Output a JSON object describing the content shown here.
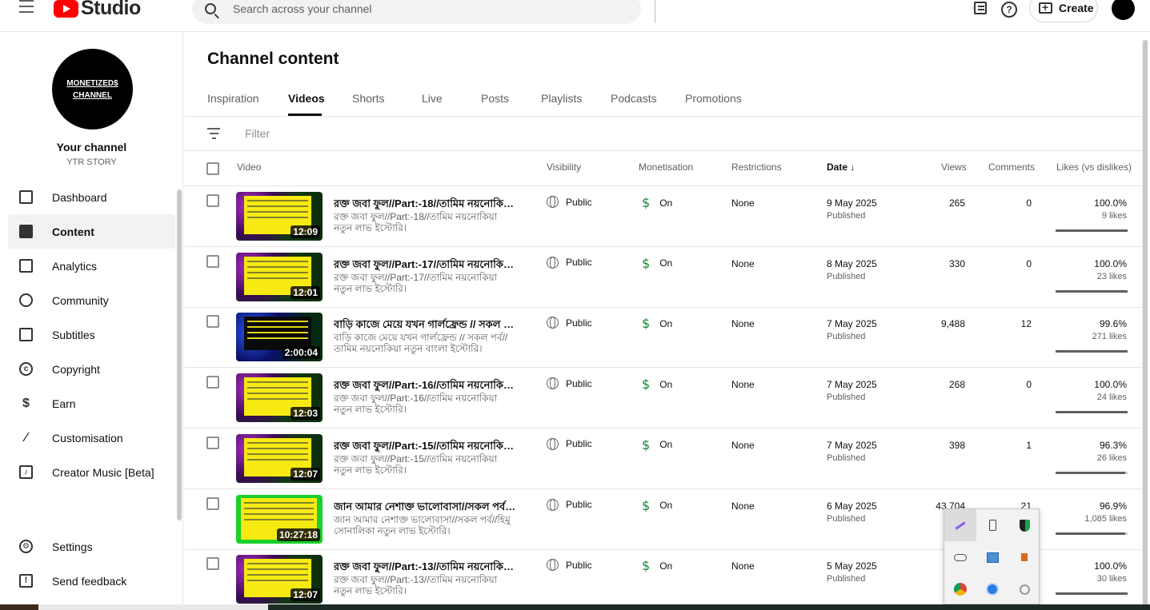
{
  "app": {
    "logo_text": "Studio"
  },
  "search": {
    "placeholder": "Search across your channel"
  },
  "header": {
    "create_label": "Create"
  },
  "channel": {
    "avatar_line1": "MONETIZED$",
    "avatar_line2": "CHANNEL",
    "title": "Your channel",
    "name": "YTR STORY"
  },
  "sidebar": {
    "items": [
      {
        "label": "Dashboard",
        "icon": "dashboard-icon"
      },
      {
        "label": "Content",
        "icon": "content-icon",
        "active": true
      },
      {
        "label": "Analytics",
        "icon": "analytics-icon"
      },
      {
        "label": "Community",
        "icon": "community-icon"
      },
      {
        "label": "Subtitles",
        "icon": "subtitles-icon"
      },
      {
        "label": "Copyright",
        "icon": "copyright-icon"
      },
      {
        "label": "Earn",
        "icon": "earn-icon"
      },
      {
        "label": "Customisation",
        "icon": "customisation-icon"
      },
      {
        "label": "Creator Music [Beta]",
        "icon": "creator-music-icon"
      }
    ],
    "bottom": [
      {
        "label": "Settings",
        "icon": "settings-icon"
      },
      {
        "label": "Send feedback",
        "icon": "feedback-icon"
      }
    ]
  },
  "main": {
    "title": "Channel content",
    "tabs": [
      "Inspiration",
      "Videos",
      "Shorts",
      "Live",
      "Posts",
      "Playlists",
      "Podcasts",
      "Promotions"
    ],
    "active_tab": "Videos",
    "filter_placeholder": "Filter"
  },
  "table": {
    "headers": {
      "video": "Video",
      "visibility": "Visibility",
      "monetisation": "Monetisation",
      "restrictions": "Restrictions",
      "date": "Date",
      "views": "Views",
      "comments": "Comments",
      "likes": "Likes (vs dislikes)"
    },
    "rows": [
      {
        "title": "রক্ত জবা ফুল//Part:-18//তামিম নয়নোকিয়া নতুন লাভ ইস্টোরি।",
        "desc": "রক্ত জবা ফুল//Part:-18//তামিম নয়নোকিয়া নতুন লাভ ইস্টোরি।",
        "duration": "12:09",
        "visibility": "Public",
        "monetisation": "On",
        "restrictions": "None",
        "date": "9 May 2025",
        "status": "Published",
        "views": "265",
        "comments": "0",
        "likes_pct": "100.0%",
        "likes_count": "9 likes",
        "likes_ratio": 1.0
      },
      {
        "title": "রক্ত জবা ফুল//Part:-17//তামিম নয়নোকিয়া নতুন লাভ ইস্টোরি।",
        "desc": "রক্ত জবা ফুল//Part:-17//তামিম নয়নোকিয়া নতুন লাভ ইস্টোরি।",
        "duration": "12:01",
        "visibility": "Public",
        "monetisation": "On",
        "restrictions": "None",
        "date": "8 May 2025",
        "status": "Published",
        "views": "330",
        "comments": "0",
        "likes_pct": "100.0%",
        "likes_count": "23 likes",
        "likes_ratio": 1.0
      },
      {
        "title": "বাড়ি কাজে মেয়ে যখন গার্লফ্রেন্ড // সকল পর্ব//",
        "desc": "বাড়ি কাজে মেয়ে যখন গার্লফ্রেন্ড // সকল পর্ব// তামিম নয়নোকিয়া নতুন বাংলা ইস্টোরি।",
        "duration": "2:00:04",
        "visibility": "Public",
        "monetisation": "On",
        "restrictions": "None",
        "date": "7 May 2025",
        "status": "Published",
        "views": "9,488",
        "comments": "12",
        "likes_pct": "99.6%",
        "likes_count": "271 likes",
        "likes_ratio": 0.996
      },
      {
        "title": "রক্ত জবা ফুল//Part:-16//তামিম নয়নোকিয়া নতুন লাভ ইস্টোরি।",
        "desc": "রক্ত জবা ফুল//Part:-16//তামিম নয়নোকিয়া নতুন লাভ ইস্টোরি।",
        "duration": "12:03",
        "visibility": "Public",
        "monetisation": "On",
        "restrictions": "None",
        "date": "7 May 2025",
        "status": "Published",
        "views": "268",
        "comments": "0",
        "likes_pct": "100.0%",
        "likes_count": "24 likes",
        "likes_ratio": 1.0
      },
      {
        "title": "রক্ত জবা ফুল//Part:-15//তামিম নয়নোকিয়া নতুন লাভ ইস্টোরি।",
        "desc": "রক্ত জবা ফুল//Part:-15//তামিম নয়নোকিয়া নতুন লাভ ইস্টোরি।",
        "duration": "12:07",
        "visibility": "Public",
        "monetisation": "On",
        "restrictions": "None",
        "date": "7 May 2025",
        "status": "Published",
        "views": "398",
        "comments": "1",
        "likes_pct": "96.3%",
        "likes_count": "26 likes",
        "likes_ratio": 0.963
      },
      {
        "title": "জান আমার নেশাক্ত ভালোবাসা//সকল পর্ব//হিমু সোনালিকা",
        "desc": "জান আমার নেশাক্ত ভালোবাসা//সকল পর্ব//হিমু সোনালিকা নতুন লাভ ইস্টোরি।",
        "duration": "10:27:18",
        "visibility": "Public",
        "monetisation": "On",
        "restrictions": "None",
        "date": "6 May 2025",
        "status": "Published",
        "views": "43,704",
        "comments": "21",
        "likes_pct": "96.9%",
        "likes_count": "1,085 likes",
        "likes_ratio": 0.969
      },
      {
        "title": "রক্ত জবা ফুল//Part:-13//তামিম নয়নোকিয়া নতুন লাভ ইস্টোরি।",
        "desc": "রক্ত জবা ফুল//Part:-13//তামিম নয়নোকিয়া নতুন লাভ ইস্টোরি।",
        "duration": "12:07",
        "visibility": "Public",
        "monetisation": "On",
        "restrictions": "None",
        "date": "5 May 2025",
        "status": "Published",
        "views": "",
        "comments": "",
        "likes_pct": "100.0%",
        "likes_count": "30 likes",
        "likes_ratio": 1.0
      }
    ]
  },
  "tray": {
    "icons": [
      "pen-icon",
      "usb-drive-icon",
      "security-shield-icon",
      "cloud-off-icon",
      "network-display-icon",
      "speaker-icon",
      "chrome-icon",
      "sync-icon",
      "webcam-icon"
    ]
  },
  "colors": {
    "accent": "#0f8a33",
    "brand_red": "#ff0000"
  }
}
